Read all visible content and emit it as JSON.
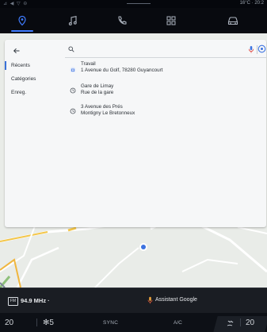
{
  "status": {
    "left": "⊿ ◀ ▽ ⊖",
    "right": "16°C · 20:2"
  },
  "nav": {
    "tabs": [
      {
        "name": "navigation",
        "icon": "location-pin-icon"
      },
      {
        "name": "music",
        "icon": "music-note-icon"
      },
      {
        "name": "phone",
        "icon": "phone-icon"
      },
      {
        "name": "apps",
        "icon": "apps-grid-icon"
      },
      {
        "name": "vehicle",
        "icon": "car-icon"
      }
    ],
    "active": 0,
    "accent": "#3f7cff"
  },
  "search": {
    "placeholder": "",
    "value": ""
  },
  "sidebar": {
    "items": [
      {
        "label": "Récents",
        "active": true
      },
      {
        "label": "Catégories",
        "active": false
      },
      {
        "label": "Enreg.",
        "active": false
      }
    ]
  },
  "results": [
    {
      "line1": "Travail",
      "line2": "1 Avenue du Golf, 78280 Guyancourt",
      "icon": "work-pin-icon"
    },
    {
      "line1": "Gare de Limay",
      "line2": "Rue de la gare",
      "icon": "history-icon"
    },
    {
      "line1": "3 Avenue des Prés",
      "line2": "Montigny Le Bretonneux",
      "icon": "history-icon"
    }
  ],
  "media": {
    "radio_icon": "FM",
    "frequency": "94.9 MHz ·",
    "assistant": "Assistant Google"
  },
  "climate": {
    "left_temp": "20",
    "fan": "5",
    "sync": "SYNC",
    "ac": "A/C",
    "right_temp": "20"
  }
}
